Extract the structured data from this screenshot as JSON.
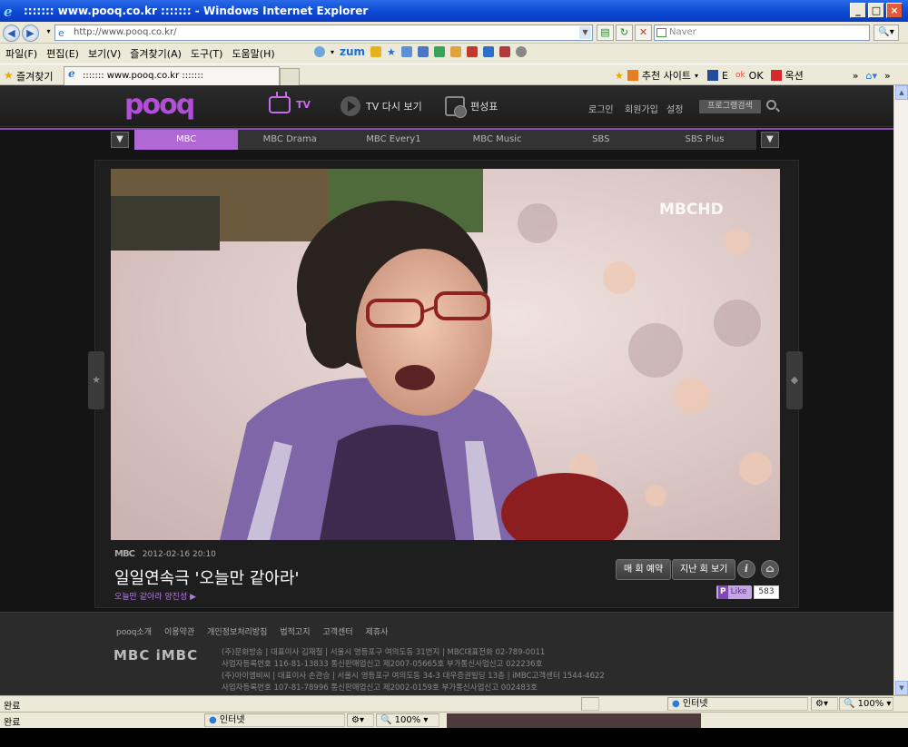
{
  "window": {
    "title": ":::::::  www.pooq.co.kr  ::::::: - Windows Internet Explorer"
  },
  "address_bar": {
    "url": "http://www.pooq.co.kr/",
    "search_placeholder": "Naver"
  },
  "menu": [
    "파일(F)",
    "편집(E)",
    "보기(V)",
    "즐겨찾기(A)",
    "도구(T)",
    "도움말(H)"
  ],
  "toolbar": {
    "zum_label": "zum"
  },
  "favorites_bar": {
    "label": "즐겨찾기",
    "tab_title": "::::::: www.pooq.co.kr :::::::",
    "links": [
      "추천 사이트",
      "E",
      "OK",
      "옥션"
    ]
  },
  "site": {
    "logo": "pooq",
    "nav": {
      "tv": "TV",
      "replay": "TV 다시 보기",
      "schedule": "편성표"
    },
    "util": {
      "login": "로그인",
      "join": "회원가입",
      "settings": "설정",
      "program_search": "프로그램검색"
    },
    "channels": [
      "MBC",
      "MBC Drama",
      "MBC Every1",
      "MBC Music",
      "SBS",
      "SBS Plus"
    ],
    "active_channel": "MBC",
    "video": {
      "watermark": "MBCHD"
    },
    "program": {
      "network": "MBC",
      "datetime": "2012-02-16 20:10",
      "title": "일일연속극 '오늘만 같아라'",
      "episode_link": "오늘만 같아라 양진성 ▶",
      "reserve_label": "매 회 예약",
      "past_label": "지난 회 보기",
      "like_label": "Like",
      "like_count": "583"
    },
    "footer": {
      "links": [
        "pooq소개",
        "이용약관",
        "개인정보처리방침",
        "법적고지",
        "고객센터",
        "제휴사"
      ],
      "logo": "MBC iMBC",
      "info": [
        "(주)문화방송 | 대표이사 김재철 | 서울시 영등포구 여의도동 31번지 | MBC대표전화 02-789-0011",
        "사업자등록번호 116-81-13833 통신판매업신고 제2007-05665호 부가통신사업신고 022236호",
        "(주)아이엠비씨 | 대표이사 손관승 | 서울시 영등포구 여의도동 34-3 대우증권빌딩 13층 | iMBC고객센터 1544-4622",
        "사업자등록번호 107-81-78996 통신판매업신고 제2002-0159호 부가통신사업신고 002483호"
      ]
    }
  },
  "status": {
    "text": "완료",
    "zone": "인터넷",
    "zoom": "100%"
  }
}
